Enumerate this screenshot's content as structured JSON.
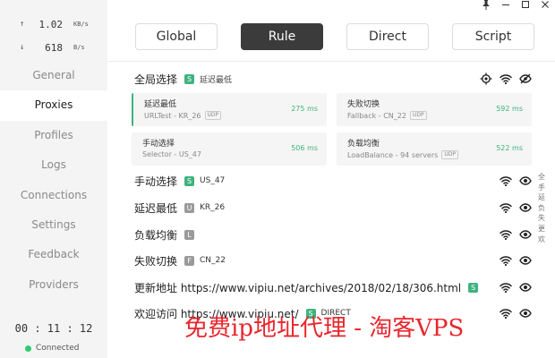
{
  "traffic": {
    "upload": {
      "value": "1.02",
      "unit": "KB/s"
    },
    "download": {
      "value": "618",
      "unit": "B/s"
    }
  },
  "sidebar": {
    "items": [
      {
        "label": "General",
        "active": false
      },
      {
        "label": "Proxies",
        "active": true
      },
      {
        "label": "Profiles",
        "active": false
      },
      {
        "label": "Logs",
        "active": false
      },
      {
        "label": "Connections",
        "active": false
      },
      {
        "label": "Settings",
        "active": false
      },
      {
        "label": "Feedback",
        "active": false
      },
      {
        "label": "Providers",
        "active": false
      }
    ],
    "timer": "00 : 11 : 12",
    "status": "Connected"
  },
  "modes": [
    {
      "label": "Global",
      "active": false
    },
    {
      "label": "Rule",
      "active": true
    },
    {
      "label": "Direct",
      "active": false
    },
    {
      "label": "Script",
      "active": false
    }
  ],
  "global_group": {
    "title": "全局选择",
    "badge": "S",
    "selected": "延迟最低"
  },
  "cards": [
    {
      "name": "延迟最低",
      "type": "URLTest",
      "node": "KR_26",
      "udp": "UDP",
      "latency": "275 ms",
      "selected": true
    },
    {
      "name": "失败切换",
      "type": "Fallback",
      "node": "CN_22",
      "udp": "UDP",
      "latency": "592 ms",
      "selected": false
    },
    {
      "name": "手动选择",
      "type": "Selector",
      "node": "US_47",
      "udp": "",
      "latency": "506 ms",
      "selected": false
    },
    {
      "name": "负载均衡",
      "type": "LoadBalance",
      "node": "94 servers",
      "udp": "UDP",
      "latency": "522 ms",
      "selected": false
    }
  ],
  "groups": [
    {
      "name": "手动选择",
      "badge": "S",
      "badge_color": "green",
      "selected": "US_47"
    },
    {
      "name": "延迟最低",
      "badge": "U",
      "badge_color": "gray",
      "selected": "KR_26"
    },
    {
      "name": "负载均衡",
      "badge": "L",
      "badge_color": "gray",
      "selected": ""
    },
    {
      "name": "失败切换",
      "badge": "F",
      "badge_color": "gray",
      "selected": "CN_22"
    },
    {
      "name": "更新地址 https://www.vipiu.net/archives/2018/02/18/306.html",
      "badge": "S",
      "badge_color": "green",
      "selected": ""
    },
    {
      "name": "欢迎访问 https://www.vipiu.net/",
      "badge": "S",
      "badge_color": "green",
      "selected": "DIRECT"
    }
  ],
  "side_letters": [
    "全",
    "手",
    "延",
    "负",
    "失",
    "更",
    "欢"
  ],
  "watermark": "免费ip地址代理 - 淘客VPS",
  "colors": {
    "accent": "#3fb27f",
    "active_mode": "#3b3b3b",
    "connected": "#2ecc71",
    "watermark": "#e8262d"
  },
  "icons": {
    "pin": "pin-icon",
    "minimize": "minimize-icon",
    "maximize": "maximize-icon",
    "close": "close-icon",
    "locate": "locate-icon",
    "wifi": "wifi-icon",
    "eye": "eye-icon",
    "eye_off": "eye-off-icon"
  }
}
